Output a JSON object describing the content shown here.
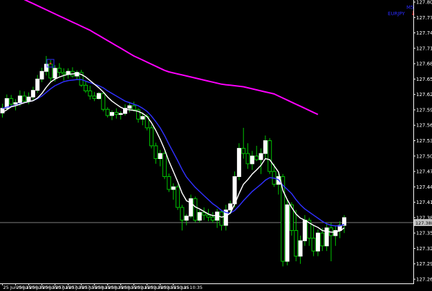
{
  "chart_data": {
    "type": "candlestick",
    "symbol": "EURJPY",
    "timeframe": "M5",
    "signal_icon": "red-down-arrow-icon",
    "ylim": [
      127.26,
      127.81
    ],
    "y_ticks": [
      "127.805",
      "127.775",
      "127.745",
      "127.715",
      "127.685",
      "127.655",
      "127.625",
      "127.595",
      "127.565",
      "127.535",
      "127.505",
      "127.475",
      "127.445",
      "127.415",
      "127.385",
      "127.355",
      "127.325",
      "127.295",
      "127.265"
    ],
    "current_price": "127.388",
    "x_ticks": [
      "25 Jun 06:15",
      "25 Jun 06:35",
      "25 Jun 06:55",
      "25 Jun 07:15",
      "25 Jun 07:35",
      "25 Jun 07:55",
      "25 Jun 08:15",
      "25 Jun 08:35",
      "25 Jun 08:55",
      "25 Jun 09:15",
      "25 Jun 09:35",
      "25 Jun 09:55",
      "25 Jun 10:15",
      "25 Jun 10:35"
    ],
    "colors": {
      "background": "#000000",
      "bull_candle": "#ffffff",
      "bear_candle": "#000000",
      "wick": "#00c800",
      "ma_fast": "#ffffff",
      "ma_mid": "#3030ff",
      "ma_slow": "#ff00ff",
      "price_line": "#808080",
      "axis": "#ffffff",
      "signal_box": "#3030ff",
      "signal_arrow": "#ff2020"
    },
    "candles": [
      [
        127.589,
        127.607,
        127.58,
        127.598
      ],
      [
        127.598,
        127.625,
        127.594,
        127.617
      ],
      [
        127.617,
        127.624,
        127.6,
        127.606
      ],
      [
        127.606,
        127.616,
        127.594,
        127.609
      ],
      [
        127.609,
        127.633,
        127.602,
        127.622
      ],
      [
        127.622,
        127.631,
        127.608,
        127.612
      ],
      [
        127.612,
        127.629,
        127.606,
        127.62
      ],
      [
        127.62,
        127.64,
        127.614,
        127.633
      ],
      [
        127.633,
        127.663,
        127.628,
        127.655
      ],
      [
        127.655,
        127.677,
        127.649,
        127.67
      ],
      [
        127.67,
        127.7,
        127.662,
        127.684
      ],
      [
        127.684,
        127.692,
        127.65,
        127.657
      ],
      [
        127.657,
        127.682,
        127.65,
        127.676
      ],
      [
        127.676,
        127.686,
        127.66,
        127.668
      ],
      [
        127.668,
        127.676,
        127.652,
        127.665
      ],
      [
        127.665,
        127.676,
        127.656,
        127.67
      ],
      [
        127.67,
        127.678,
        127.658,
        127.661
      ],
      [
        127.661,
        127.672,
        127.654,
        127.668
      ],
      [
        127.668,
        127.673,
        127.64,
        127.643
      ],
      [
        127.643,
        127.65,
        127.628,
        127.632
      ],
      [
        127.632,
        127.642,
        127.615,
        127.622
      ],
      [
        127.622,
        127.63,
        127.612,
        127.617
      ],
      [
        127.617,
        127.63,
        127.615,
        127.627
      ],
      [
        127.627,
        127.63,
        127.592,
        127.596
      ],
      [
        127.596,
        127.6,
        127.58,
        127.584
      ],
      [
        127.584,
        127.594,
        127.575,
        127.59
      ],
      [
        127.59,
        127.598,
        127.578,
        127.586
      ],
      [
        127.586,
        127.592,
        127.576,
        127.588
      ],
      [
        127.588,
        127.606,
        127.584,
        127.598
      ],
      [
        127.598,
        127.61,
        127.59,
        127.603
      ],
      [
        127.603,
        127.611,
        127.592,
        127.595
      ],
      [
        127.595,
        127.598,
        127.57,
        127.577
      ],
      [
        127.577,
        127.59,
        127.565,
        127.582
      ],
      [
        127.582,
        127.587,
        127.555,
        127.56
      ],
      [
        127.56,
        127.566,
        127.52,
        127.525
      ],
      [
        127.525,
        127.531,
        127.49,
        127.5
      ],
      [
        127.5,
        127.517,
        127.485,
        127.51
      ],
      [
        127.51,
        127.514,
        127.46,
        127.465
      ],
      [
        127.465,
        127.471,
        127.435,
        127.44
      ],
      [
        127.44,
        127.452,
        127.42,
        127.445
      ],
      [
        127.445,
        127.45,
        127.4,
        127.405
      ],
      [
        127.405,
        127.41,
        127.36,
        127.38
      ],
      [
        127.38,
        127.392,
        127.37,
        127.388
      ],
      [
        127.388,
        127.43,
        127.384,
        127.422
      ],
      [
        127.422,
        127.426,
        127.376,
        127.38
      ],
      [
        127.38,
        127.4,
        127.375,
        127.395
      ],
      [
        127.395,
        127.405,
        127.38,
        127.39
      ],
      [
        127.39,
        127.402,
        127.378,
        127.386
      ],
      [
        127.386,
        127.396,
        127.375,
        127.38
      ],
      [
        127.38,
        127.402,
        127.365,
        127.396
      ],
      [
        127.396,
        127.4,
        127.36,
        127.37
      ],
      [
        127.37,
        127.41,
        127.36,
        127.4
      ],
      [
        127.4,
        127.418,
        127.392,
        127.412
      ],
      [
        127.412,
        127.475,
        127.405,
        127.465
      ],
      [
        127.465,
        127.53,
        127.458,
        127.52
      ],
      [
        127.52,
        127.56,
        127.5,
        127.51
      ],
      [
        127.51,
        127.53,
        127.48,
        127.49
      ],
      [
        127.49,
        127.515,
        127.478,
        127.505
      ],
      [
        127.505,
        127.525,
        127.495,
        127.498
      ],
      [
        127.498,
        127.52,
        127.47,
        127.51
      ],
      [
        127.51,
        127.545,
        127.498,
        127.535
      ],
      [
        127.535,
        127.54,
        127.47,
        127.475
      ],
      [
        127.475,
        127.49,
        127.445,
        127.45
      ],
      [
        127.45,
        127.472,
        127.43,
        127.465
      ],
      [
        127.465,
        127.47,
        127.29,
        127.3
      ],
      [
        127.3,
        127.42,
        127.292,
        127.41
      ],
      [
        127.41,
        127.415,
        127.35,
        127.36
      ],
      [
        127.36,
        127.4,
        127.3,
        127.31
      ],
      [
        127.31,
        127.35,
        127.295,
        127.34
      ],
      [
        127.34,
        127.39,
        127.33,
        127.38
      ],
      [
        127.38,
        127.385,
        127.33,
        127.345
      ],
      [
        127.345,
        127.37,
        127.31,
        127.32
      ],
      [
        127.32,
        127.362,
        127.31,
        127.355
      ],
      [
        127.355,
        127.365,
        127.32,
        127.33
      ],
      [
        127.33,
        127.372,
        127.32,
        127.365
      ],
      [
        127.365,
        127.375,
        127.3,
        127.35
      ],
      [
        127.35,
        127.37,
        127.33,
        127.36
      ],
      [
        127.36,
        127.378,
        127.345,
        127.37
      ],
      [
        127.37,
        127.39,
        127.355,
        127.385
      ]
    ],
    "ma_fast": [
      127.59,
      127.595,
      127.601,
      127.603,
      127.606,
      127.609,
      127.611,
      127.613,
      127.618,
      127.627,
      127.639,
      127.649,
      127.655,
      127.659,
      127.662,
      127.664,
      127.665,
      127.666,
      127.664,
      127.659,
      127.652,
      127.645,
      127.638,
      127.63,
      127.62,
      127.612,
      127.606,
      127.6,
      127.596,
      127.595,
      127.594,
      127.592,
      127.588,
      127.582,
      127.57,
      127.555,
      127.538,
      127.518,
      127.495,
      127.475,
      127.455,
      127.433,
      127.418,
      127.414,
      127.406,
      127.402,
      127.397,
      127.392,
      127.389,
      127.389,
      127.386,
      127.388,
      127.394,
      127.411,
      127.432,
      127.45,
      127.459,
      127.47,
      127.478,
      127.487,
      127.5,
      127.498,
      127.486,
      127.474,
      127.438,
      127.42,
      127.405,
      127.392,
      127.384,
      127.38,
      127.375,
      127.37,
      127.366,
      127.36,
      127.358,
      127.357,
      127.357,
      127.359,
      127.365
    ],
    "ma_mid": [
      127.598,
      127.6,
      127.602,
      127.604,
      127.607,
      127.609,
      127.611,
      127.613,
      127.617,
      127.622,
      127.629,
      127.636,
      127.642,
      127.646,
      127.65,
      127.652,
      127.653,
      127.654,
      127.654,
      127.651,
      127.648,
      127.645,
      127.642,
      127.638,
      127.632,
      127.627,
      127.622,
      127.617,
      127.612,
      127.609,
      127.606,
      127.603,
      127.598,
      127.592,
      127.583,
      127.572,
      127.56,
      127.545,
      127.528,
      127.512,
      127.496,
      127.479,
      127.464,
      127.454,
      127.444,
      127.436,
      127.428,
      127.42,
      127.412,
      127.406,
      127.399,
      127.395,
      127.394,
      127.399,
      127.408,
      127.418,
      127.427,
      127.436,
      127.443,
      127.45,
      127.458,
      127.463,
      127.462,
      127.459,
      127.448,
      127.44,
      127.432,
      127.42,
      127.41,
      127.402,
      127.396,
      127.39,
      127.384,
      127.378,
      127.373,
      127.37,
      127.369,
      127.369,
      127.372
    ],
    "ma_slow": [
      127.83,
      127.826,
      127.822,
      127.818,
      127.814,
      127.81,
      127.806,
      127.802,
      127.798,
      127.794,
      127.79,
      127.786,
      127.782,
      127.778,
      127.774,
      127.77,
      127.766,
      127.762,
      127.758,
      127.754,
      127.75,
      127.745,
      127.74,
      127.735,
      127.73,
      127.725,
      127.72,
      127.715,
      127.71,
      127.705,
      127.7,
      127.696,
      127.692,
      127.688,
      127.684,
      127.68,
      127.676,
      127.672,
      127.669,
      127.667,
      127.665,
      127.663,
      127.661,
      127.659,
      127.657,
      127.655,
      127.653,
      127.651,
      127.649,
      127.647,
      127.645,
      127.644,
      127.643,
      127.642,
      127.641,
      127.64,
      127.638,
      127.636,
      127.634,
      127.632,
      127.63,
      127.628,
      127.626,
      127.622,
      127.618,
      127.614,
      127.61,
      127.606,
      127.602,
      127.598,
      127.594,
      127.59,
      127.586
    ]
  }
}
